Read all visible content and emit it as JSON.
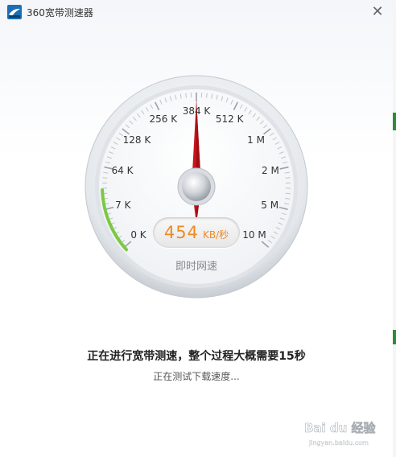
{
  "window": {
    "title": "360宽带测速器",
    "close_symbol": "✕"
  },
  "gauge": {
    "ticks": [
      "0 K",
      "7 K",
      "64 K",
      "128 K",
      "256 K",
      "384 K",
      "512 K",
      "1 M",
      "2 M",
      "5 M",
      "10 M"
    ],
    "speed_value": "454",
    "speed_unit": "KB/秒",
    "caption": "即时网速",
    "accent_color": "#f08a22",
    "needle_color": "#c8141b",
    "progress_color": "#7ac943"
  },
  "status": {
    "main_text": "正在进行宽带测速，整个过程大概需要15秒",
    "sub_text": "正在测试下载速度..."
  },
  "watermark": {
    "text": "Bai du 经验",
    "sub": "jingyan.baidu.com"
  }
}
